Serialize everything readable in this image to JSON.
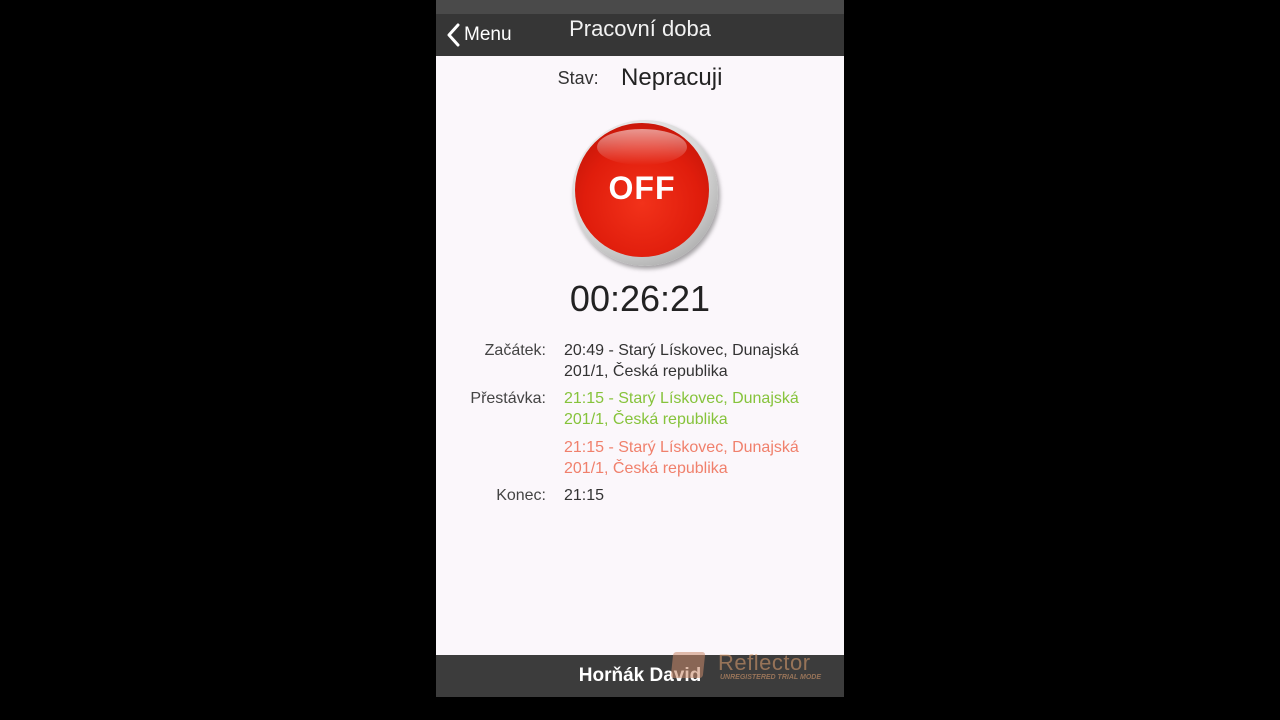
{
  "navbar": {
    "back_label": "Menu",
    "title": "Pracovní doba"
  },
  "status": {
    "label": "Stav:",
    "value": "Nepracuji"
  },
  "power_button": {
    "label": "OFF",
    "color": "#e01d0c"
  },
  "timer": "00:26:21",
  "records": {
    "start": {
      "label": "Začátek:",
      "lines": [
        "20:49 - Starý Lískovec, Dunajská",
        "201/1, Česká republika"
      ]
    },
    "break": {
      "label": "Přestávka:",
      "start_lines": [
        "21:15 - Starý Lískovec, Dunajská",
        "201/1, Česká republika"
      ],
      "end_lines": [
        "21:15 - Starý Lískovec, Dunajská",
        "201/1, Česká republika"
      ],
      "start_color": "#86c33b",
      "end_color": "#f0806c"
    },
    "end": {
      "label": "Konec:",
      "value": "21:15"
    }
  },
  "footer": {
    "user_name": "Horňák David"
  },
  "watermark": {
    "title": "Reflector",
    "subtitle": "UNREGISTERED TRIAL MODE"
  }
}
